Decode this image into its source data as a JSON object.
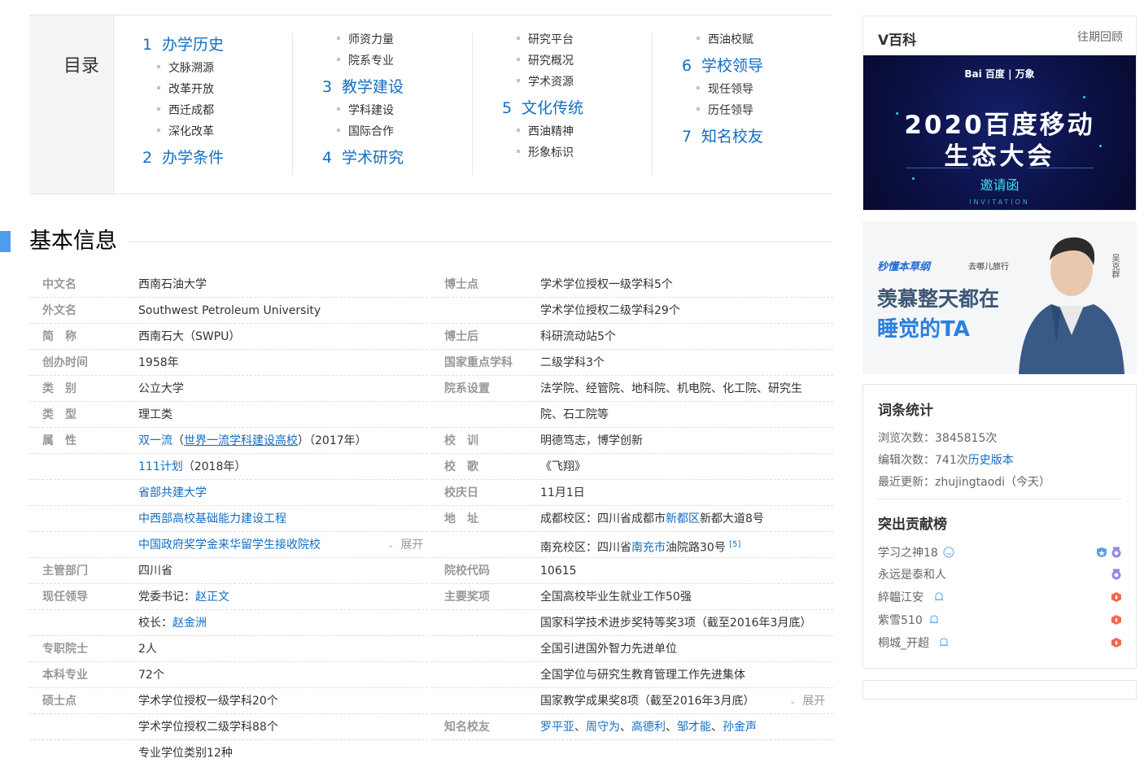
{
  "toc": {
    "title": "目录",
    "cols": [
      {
        "items": [
          {
            "level": 1,
            "num": "1",
            "text": "办学历史"
          },
          {
            "level": 2,
            "text": "文脉溯源"
          },
          {
            "level": 2,
            "text": "改革开放"
          },
          {
            "level": 2,
            "text": "西迁成都"
          },
          {
            "level": 2,
            "text": "深化改革"
          },
          {
            "level": 1,
            "num": "2",
            "text": "办学条件"
          }
        ]
      },
      {
        "items": [
          {
            "level": 2,
            "text": "师资力量"
          },
          {
            "level": 2,
            "text": "院系专业"
          },
          {
            "level": 1,
            "num": "3",
            "text": "教学建设"
          },
          {
            "level": 2,
            "text": "学科建设"
          },
          {
            "level": 2,
            "text": "国际合作"
          },
          {
            "level": 1,
            "num": "4",
            "text": "学术研究"
          }
        ]
      },
      {
        "items": [
          {
            "level": 2,
            "text": "研究平台"
          },
          {
            "level": 2,
            "text": "研究概况"
          },
          {
            "level": 2,
            "text": "学术资源"
          },
          {
            "level": 1,
            "num": "5",
            "text": "文化传统"
          },
          {
            "level": 2,
            "text": "西油精神"
          },
          {
            "level": 2,
            "text": "形象标识"
          }
        ]
      },
      {
        "items": [
          {
            "level": 2,
            "text": "西油校赋"
          },
          {
            "level": 1,
            "num": "6",
            "text": "学校领导"
          },
          {
            "level": 2,
            "text": "现任领导"
          },
          {
            "level": 2,
            "text": "历任领导"
          },
          {
            "level": 1,
            "num": "7",
            "text": "知名校友"
          }
        ]
      }
    ]
  },
  "section": {
    "title": "基本信息"
  },
  "left": {
    "r0": {
      "label": "中文名",
      "value": "西南石油大学"
    },
    "r1": {
      "label": "外文名",
      "value": "Southwest Petroleum University"
    },
    "r2": {
      "label": "简　称",
      "value": "西南石大（SWPU）"
    },
    "r3": {
      "label": "创办时间",
      "value": "1958年"
    },
    "r4": {
      "label": "类　别",
      "value": "公立大学"
    },
    "r5": {
      "label": "类　型",
      "value": "理工类"
    },
    "r6": {
      "label": "属　性",
      "link1": "双一流",
      "p1": "（",
      "link2": "世界一流学科建设高校",
      "p2": "）（2017年）"
    },
    "r7": {
      "link": "111计划",
      "rest": "（2018年）"
    },
    "r8": {
      "link": "省部共建大学"
    },
    "r9": {
      "link": "中西部高校基础能力建设工程"
    },
    "r10": {
      "link": "中国政府奖学金来华留学生接收院校",
      "expand": "展开"
    },
    "r11": {
      "label": "主管部门",
      "value": "四川省"
    },
    "r12": {
      "label": "现任领导",
      "pre": "党委书记：",
      "link": "赵正文"
    },
    "r13": {
      "pre": "校长：",
      "link": "赵金洲"
    },
    "r14": {
      "label": "专职院士",
      "value": "2人"
    },
    "r15": {
      "label": "本科专业",
      "value": "72个"
    },
    "r16": {
      "label": "硕士点",
      "value": "学术学位授权一级学科20个"
    },
    "r17": {
      "value": "学术学位授权二级学科88个"
    },
    "r18": {
      "value": "专业学位类别12种"
    }
  },
  "right": {
    "r0": {
      "label": "博士点",
      "value": "学术学位授权一级学科5个"
    },
    "r1": {
      "value": "学术学位授权二级学科29个"
    },
    "r2": {
      "label": "博士后",
      "value": "科研流动站5个"
    },
    "r3": {
      "label": "国家重点学科",
      "value": "二级学科3个"
    },
    "r4": {
      "label": "院系设置",
      "value": "法学院、经管院、地科院、机电院、化工院、研究生"
    },
    "r5": {
      "value": "院、石工院等"
    },
    "r6": {
      "label": "校　训",
      "value": "明德笃志，博学创新"
    },
    "r7": {
      "label": "校　歌",
      "value": "《飞翔》"
    },
    "r8": {
      "label": "校庆日",
      "value": "11月1日"
    },
    "r9": {
      "label": "地　址",
      "pre": "成都校区：四川省成都市",
      "link": "新都区",
      "post": "新都大道8号"
    },
    "r10": {
      "pre": "南充校区：四川省",
      "link": "南充市",
      "post": "油院路30号",
      "ref": "[5]"
    },
    "r11": {
      "label": "院校代码",
      "value": "10615"
    },
    "r12": {
      "label": "主要奖项",
      "value": "全国高校毕业生就业工作50强"
    },
    "r13": {
      "value": "国家科学技术进步奖特等奖3项（截至2016年3月底）"
    },
    "r14": {
      "value": "全国引进国外智力先进单位"
    },
    "r15": {
      "value": "全国学位与研究生教育管理工作先进集体"
    },
    "r16": {
      "value": "国家教学成果奖8项（截至2016年3月底）",
      "expand": "展开"
    },
    "r17": {
      "label": "知名校友",
      "links": [
        "罗平亚",
        "周守为",
        "高德利",
        "邹才能",
        "孙金声"
      ],
      "sep": "、"
    }
  },
  "sidebar": {
    "vbaike": {
      "title": "V百科",
      "more": "往期回顾",
      "banner": {
        "logo": "Bai 百度 | 万象",
        "line1": "2020百度移动",
        "line2": "生态大会",
        "line3": "邀请函",
        "line4": "INVITATION"
      }
    },
    "ad": {
      "logo": "秒懂本草纲",
      "logo2": "去哪儿旅行",
      "line1": "羡慕整天都在",
      "line2": "睡觉的TA",
      "vertical": "吴克群"
    },
    "stats": {
      "title": "词条统计",
      "views_label": "浏览次数：",
      "views": "3845815次",
      "edits_label": "编辑次数：",
      "edits": "741次",
      "history_link": "历史版本",
      "updated_label": "最近更新：",
      "updated": "zhujingtaodi（今天）",
      "contrib_title": "突出贡献榜",
      "contributors": [
        {
          "name": "学习之神18"
        },
        {
          "name": "永远是泰和人"
        },
        {
          "name": "綷韞江安"
        },
        {
          "name": "紫雪510"
        },
        {
          "name": "桐城_开超"
        }
      ]
    }
  },
  "colors": {
    "link": "#136ec2",
    "accent": "#4f9cee",
    "label": "#999999",
    "text": "#333333"
  }
}
